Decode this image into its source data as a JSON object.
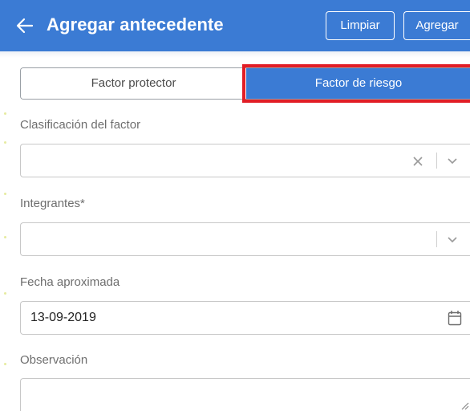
{
  "header": {
    "title": "Agregar antecedente",
    "back_icon": "arrow-left-icon",
    "buttons": {
      "clear": "Limpiar",
      "add": "Agregar"
    },
    "color": "#3b7bd4"
  },
  "toggle": {
    "options": [
      "Factor protector",
      "Factor de riesgo"
    ],
    "selected": "Factor de riesgo",
    "highlight_color": "#e11d26"
  },
  "form": {
    "clasificacion": {
      "label": "Clasificación del factor",
      "value": "",
      "icons": [
        "close-icon",
        "chevron-down-icon"
      ]
    },
    "integrantes": {
      "label": "Integrantes*",
      "value": "",
      "icons": [
        "chevron-down-icon"
      ]
    },
    "fecha": {
      "label": "Fecha aproximada",
      "value": "13-09-2019",
      "icons": [
        "calendar-icon"
      ]
    },
    "observacion": {
      "label": "Observación",
      "value": "",
      "icons": [
        "resize-handle-icon"
      ]
    }
  }
}
